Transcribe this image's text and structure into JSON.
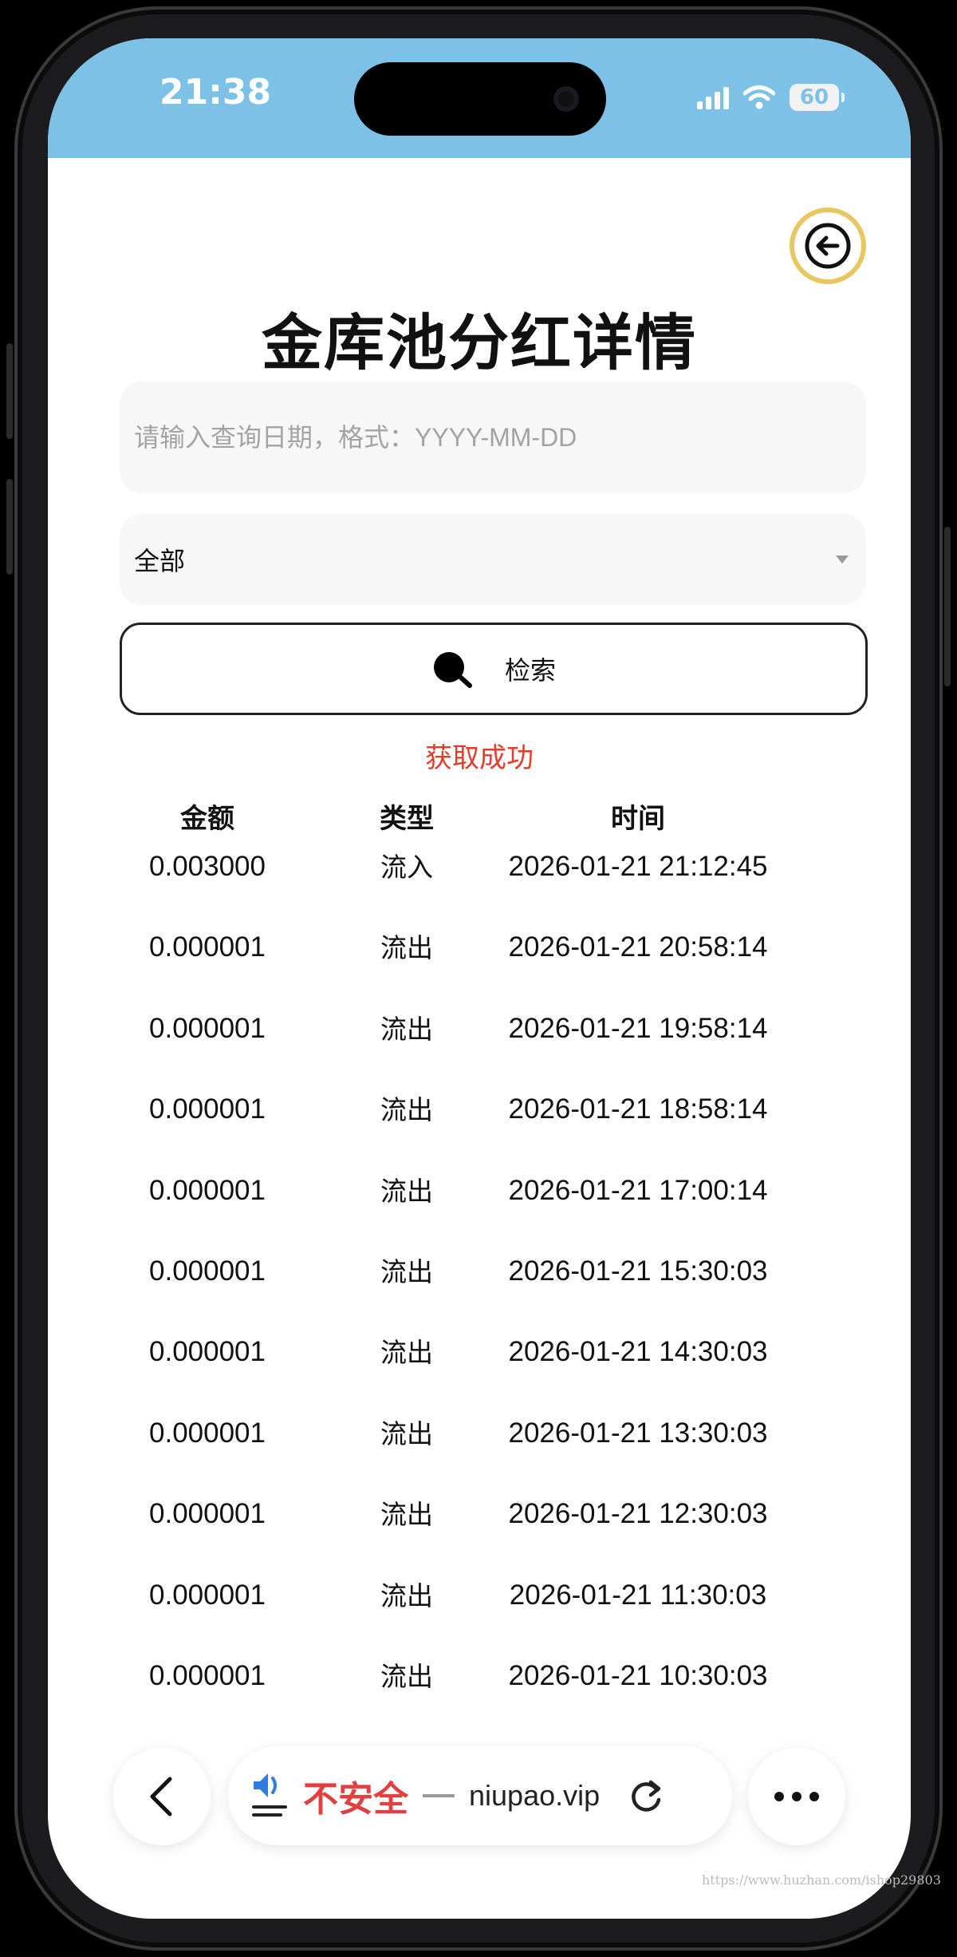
{
  "status_bar": {
    "time": "21:38",
    "battery": "60"
  },
  "header": {
    "title": "金库池分红详情"
  },
  "search": {
    "date_placeholder": "请输入查询日期，格式：YYYY-MM-DD",
    "type_selected": "全部",
    "button_label": "检索"
  },
  "status_message": "获取成功",
  "table": {
    "columns": [
      "金额",
      "类型",
      "时间"
    ],
    "rows": [
      [
        "0.003000",
        "流入",
        "2026-01-21 21:12:45"
      ],
      [
        "0.000001",
        "流出",
        "2026-01-21 20:58:14"
      ],
      [
        "0.000001",
        "流出",
        "2026-01-21 19:58:14"
      ],
      [
        "0.000001",
        "流出",
        "2026-01-21 18:58:14"
      ],
      [
        "0.000001",
        "流出",
        "2026-01-21 17:00:14"
      ],
      [
        "0.000001",
        "流出",
        "2026-01-21 15:30:03"
      ],
      [
        "0.000001",
        "流出",
        "2026-01-21 14:30:03"
      ],
      [
        "0.000001",
        "流出",
        "2026-01-21 13:30:03"
      ],
      [
        "0.000001",
        "流出",
        "2026-01-21 12:30:03"
      ],
      [
        "0.000001",
        "流出",
        "2026-01-21 11:30:03"
      ],
      [
        "0.000001",
        "流出",
        "2026-01-21 10:30:03"
      ]
    ]
  },
  "browser_bar": {
    "security_label": "不安全",
    "domain": "niupao.vip"
  },
  "watermark": "https://www.huzhan.com/ishop29803",
  "colors": {
    "status_bar_bg": "#7dc1e6",
    "status_message": "#e23c2a",
    "insecure_label": "#e04040",
    "back_button_ring": "#e8c763"
  },
  "icons": {
    "back": "arrow-left-circle-icon",
    "search": "magnifier-icon",
    "dropdown": "caret-down-icon",
    "nav_back": "chevron-left-icon",
    "speaker": "speaker-icon",
    "reload": "reload-icon",
    "more": "more-dots-icon"
  }
}
